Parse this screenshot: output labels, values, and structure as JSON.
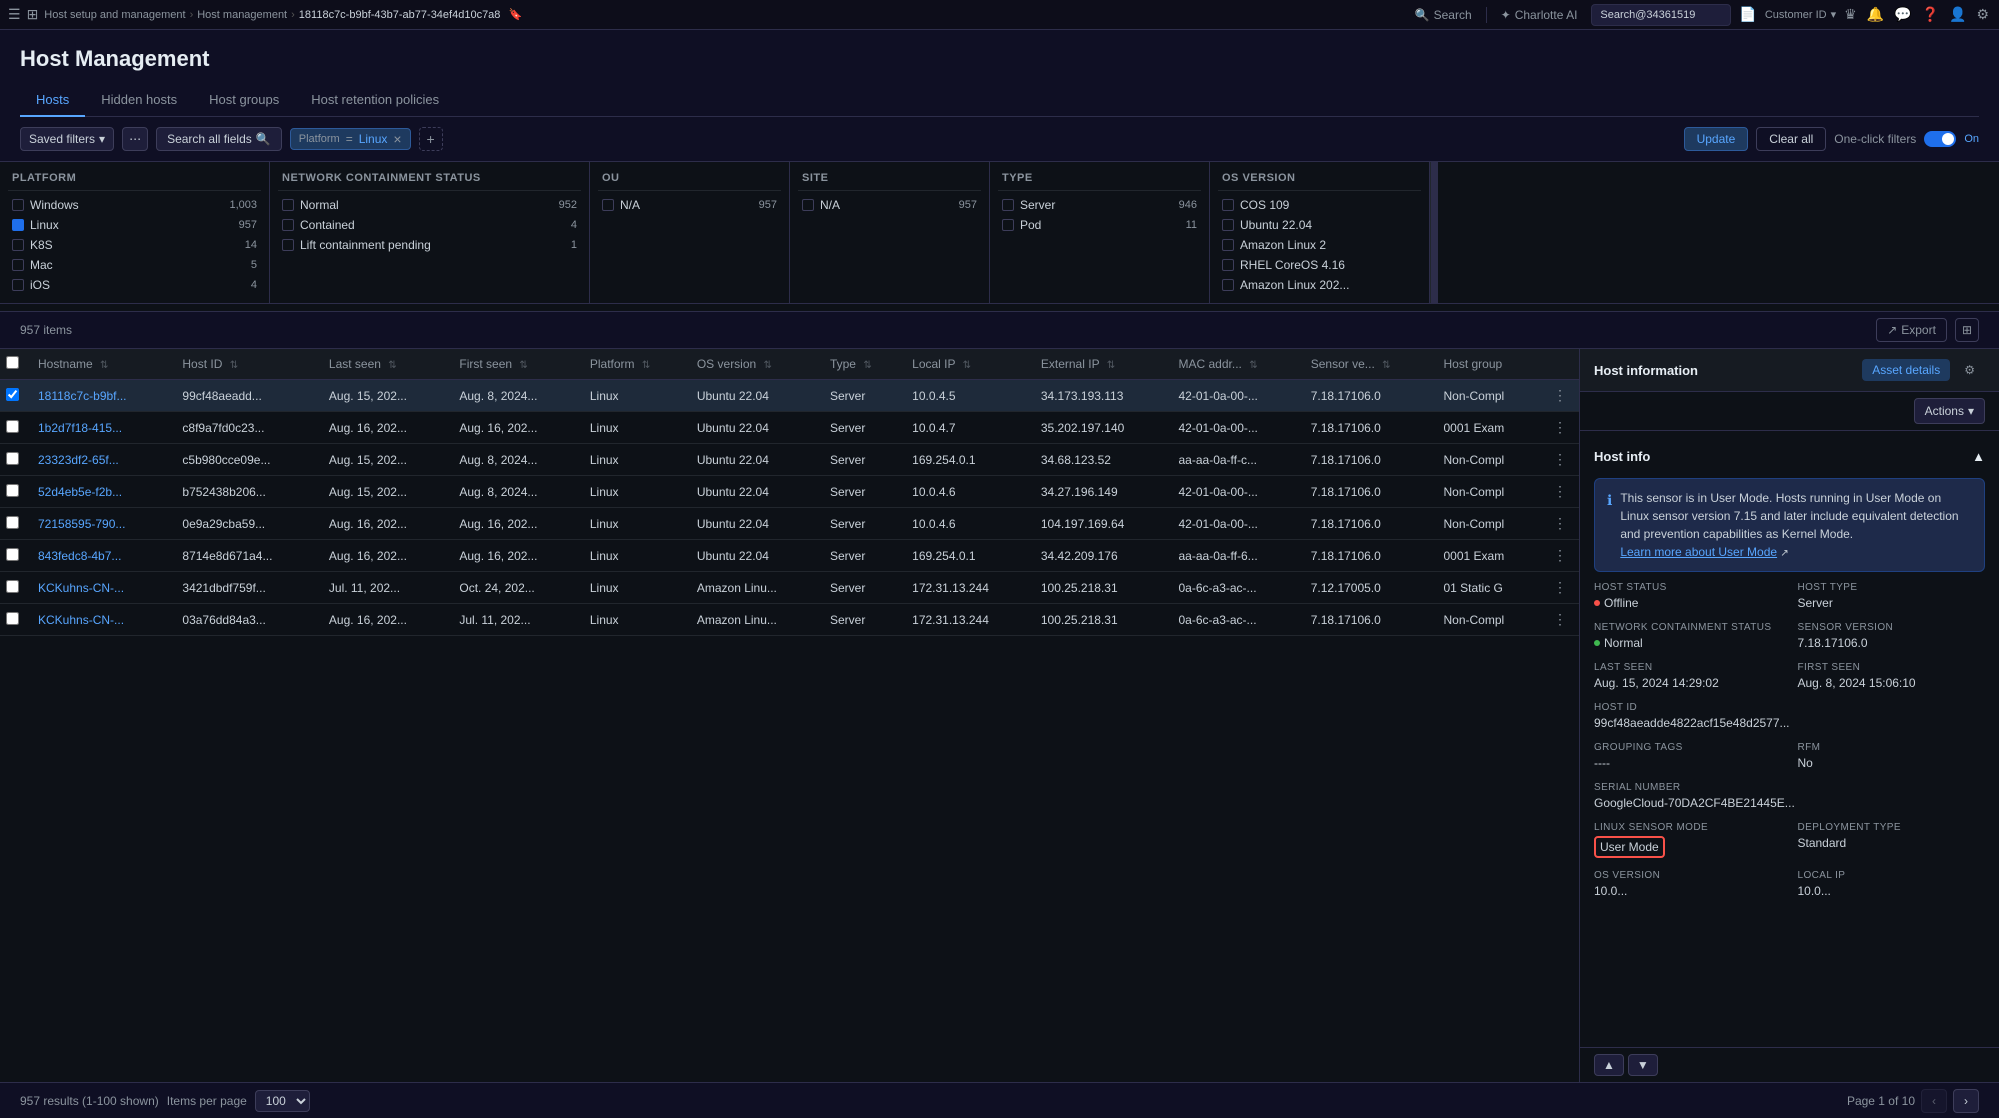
{
  "topbar": {
    "menu_icon": "≡",
    "grid_icon": "⊞",
    "breadcrumb": {
      "root": "Host setup and management",
      "parent": "Host management",
      "current": "18118c7c-b9bf-43b7-ab77-34ef4d10c7a8"
    },
    "bookmark_icon": "🔖",
    "search_label": "Search",
    "divider": "|",
    "charlotte_label": "Charlotte AI",
    "top_search_value": "Search@34361519",
    "customer_id_label": "Customer ID",
    "icons": [
      "📄",
      "🔔",
      "💬",
      "❓",
      "👤",
      "⚙️"
    ]
  },
  "page": {
    "title": "Host Management",
    "tabs": [
      {
        "id": "hosts",
        "label": "Hosts",
        "active": true
      },
      {
        "id": "hidden-hosts",
        "label": "Hidden hosts",
        "active": false
      },
      {
        "id": "host-groups",
        "label": "Host groups",
        "active": false
      },
      {
        "id": "host-retention",
        "label": "Host retention policies",
        "active": false
      }
    ]
  },
  "filter_bar": {
    "saved_filters_label": "Saved filters",
    "search_all_label": "Search all fields",
    "filter_chip_label": "Platform",
    "filter_chip_value": "Linux",
    "add_filter_icon": "+",
    "update_label": "Update",
    "clear_label": "Clear all",
    "one_click_label": "One-click filters",
    "toggle_on_label": "On"
  },
  "facets": {
    "platform": {
      "header": "Platform",
      "items": [
        {
          "label": "Windows",
          "count": "1,003",
          "checked": false
        },
        {
          "label": "Linux",
          "count": "957",
          "checked": true
        },
        {
          "label": "K8S",
          "count": "14",
          "checked": false
        },
        {
          "label": "Mac",
          "count": "5",
          "checked": false
        },
        {
          "label": "iOS",
          "count": "4",
          "checked": false
        }
      ]
    },
    "network_containment": {
      "header": "Network containment status",
      "items": [
        {
          "label": "Normal",
          "count": "952",
          "checked": false
        },
        {
          "label": "Contained",
          "count": "4",
          "checked": false
        },
        {
          "label": "Lift containment pending",
          "count": "1",
          "checked": false
        }
      ]
    },
    "ou": {
      "header": "OU",
      "items": [
        {
          "label": "N/A",
          "count": "957",
          "checked": false
        }
      ]
    },
    "site": {
      "header": "Site",
      "items": [
        {
          "label": "N/A",
          "count": "957",
          "checked": false
        }
      ]
    },
    "type": {
      "header": "Type",
      "items": [
        {
          "label": "Server",
          "count": "946",
          "checked": false
        },
        {
          "label": "Pod",
          "count": "11",
          "checked": false
        }
      ]
    },
    "os_version": {
      "header": "OS Version",
      "items": [
        {
          "label": "COS 109",
          "count": "",
          "checked": false
        },
        {
          "label": "Ubuntu 22.04",
          "count": "",
          "checked": false
        },
        {
          "label": "Amazon Linux 2",
          "count": "",
          "checked": false
        },
        {
          "label": "RHEL CoreOS 4.16",
          "count": "",
          "checked": false
        },
        {
          "label": "Amazon Linux 202...",
          "count": "",
          "checked": false
        }
      ]
    }
  },
  "results": {
    "count_label": "957 items",
    "export_label": "Export"
  },
  "table": {
    "columns": [
      "Hostname",
      "Host ID",
      "Last seen",
      "First seen",
      "Platform",
      "OS version",
      "Type",
      "Local IP",
      "External IP",
      "MAC addr...",
      "Sensor ve...",
      "Host group"
    ],
    "rows": [
      {
        "hostname": "18118c7c-b9bf...",
        "host_id": "99cf48aeadd...",
        "last_seen": "Aug. 15, 202...",
        "first_seen": "Aug. 8, 2024...",
        "platform": "Linux",
        "os_version": "Ubuntu 22.04",
        "type": "Server",
        "local_ip": "10.0.4.5",
        "external_ip": "34.173.193.113",
        "mac_addr": "42-01-0a-00-...",
        "sensor_ver": "7.18.17106.0",
        "host_group": "Non-Compl",
        "selected": true
      },
      {
        "hostname": "1b2d7f18-415...",
        "host_id": "c8f9a7fd0c23...",
        "last_seen": "Aug. 16, 202...",
        "first_seen": "Aug. 16, 202...",
        "platform": "Linux",
        "os_version": "Ubuntu 22.04",
        "type": "Server",
        "local_ip": "10.0.4.7",
        "external_ip": "35.202.197.140",
        "mac_addr": "42-01-0a-00-...",
        "sensor_ver": "7.18.17106.0",
        "host_group": "0001 Exam",
        "selected": false
      },
      {
        "hostname": "23323df2-65f...",
        "host_id": "c5b980cce09e...",
        "last_seen": "Aug. 15, 202...",
        "first_seen": "Aug. 8, 2024...",
        "platform": "Linux",
        "os_version": "Ubuntu 22.04",
        "type": "Server",
        "local_ip": "169.254.0.1",
        "external_ip": "34.68.123.52",
        "mac_addr": "aa-aa-0a-ff-c...",
        "sensor_ver": "7.18.17106.0",
        "host_group": "Non-Compl",
        "selected": false
      },
      {
        "hostname": "52d4eb5e-f2b...",
        "host_id": "b752438b206...",
        "last_seen": "Aug. 15, 202...",
        "first_seen": "Aug. 8, 2024...",
        "platform": "Linux",
        "os_version": "Ubuntu 22.04",
        "type": "Server",
        "local_ip": "10.0.4.6",
        "external_ip": "34.27.196.149",
        "mac_addr": "42-01-0a-00-...",
        "sensor_ver": "7.18.17106.0",
        "host_group": "Non-Compl",
        "selected": false
      },
      {
        "hostname": "72158595-790...",
        "host_id": "0e9a29cba59...",
        "last_seen": "Aug. 16, 202...",
        "first_seen": "Aug. 16, 202...",
        "platform": "Linux",
        "os_version": "Ubuntu 22.04",
        "type": "Server",
        "local_ip": "10.0.4.6",
        "external_ip": "104.197.169.64",
        "mac_addr": "42-01-0a-00-...",
        "sensor_ver": "7.18.17106.0",
        "host_group": "Non-Compl",
        "selected": false
      },
      {
        "hostname": "843fedc8-4b7...",
        "host_id": "8714e8d671a4...",
        "last_seen": "Aug. 16, 202...",
        "first_seen": "Aug. 16, 202...",
        "platform": "Linux",
        "os_version": "Ubuntu 22.04",
        "type": "Server",
        "local_ip": "169.254.0.1",
        "external_ip": "34.42.209.176",
        "mac_addr": "aa-aa-0a-ff-6...",
        "sensor_ver": "7.18.17106.0",
        "host_group": "0001 Exam",
        "selected": false
      },
      {
        "hostname": "KCKuhns-CN-...",
        "host_id": "3421dbdf759f...",
        "last_seen": "Jul. 11, 202...",
        "first_seen": "Oct. 24, 202...",
        "platform": "Linux",
        "os_version": "Amazon Linu...",
        "type": "Server",
        "local_ip": "172.31.13.244",
        "external_ip": "100.25.218.31",
        "mac_addr": "0a-6c-a3-ac-...",
        "sensor_ver": "7.12.17005.0",
        "host_group": "01 Static G",
        "selected": false
      },
      {
        "hostname": "KCKuhns-CN-...",
        "host_id": "03a76dd84a3...",
        "last_seen": "Aug. 16, 202...",
        "first_seen": "Jul. 11, 202...",
        "platform": "Linux",
        "os_version": "Amazon Linu...",
        "type": "Server",
        "local_ip": "172.31.13.244",
        "external_ip": "100.25.218.31",
        "mac_addr": "0a-6c-a3-ac-...",
        "sensor_ver": "7.18.17106.0",
        "host_group": "Non-Compl",
        "selected": false
      }
    ]
  },
  "detail_panel": {
    "title": "Host information",
    "tabs": [
      {
        "label": "Asset details",
        "active": true
      },
      {
        "label": "⚙",
        "active": false
      }
    ],
    "actions_label": "Actions",
    "host_info_section": "Host info",
    "info_banner": "This sensor is in User Mode. Hosts running in User Mode on Linux sensor version 7.15 and later include equivalent detection and prevention capabilities as Kernel Mode.",
    "learn_more_label": "Learn more about User Mode",
    "fields": {
      "host_status_label": "Host status",
      "host_status_value": "Offline",
      "host_type_label": "Host type",
      "host_type_value": "Server",
      "network_containment_label": "Network containment status",
      "network_containment_value": "Normal",
      "sensor_version_label": "Sensor version",
      "sensor_version_value": "7.18.17106.0",
      "last_seen_label": "Last seen",
      "last_seen_value": "Aug. 15, 2024 14:29:02",
      "first_seen_label": "First seen",
      "first_seen_value": "Aug. 8, 2024 15:06:10",
      "host_id_label": "Host ID",
      "host_id_value": "99cf48aeadde4822acf15e48d2577...",
      "grouping_tags_label": "Grouping tags",
      "grouping_tags_value": "----",
      "rfm_label": "RFM",
      "rfm_value": "No",
      "serial_number_label": "Serial number",
      "serial_number_value": "GoogleCloud-70DA2CF4BE21445E...",
      "linux_sensor_mode_label": "Linux sensor mode",
      "linux_sensor_mode_value": "User Mode",
      "deployment_type_label": "Deployment type",
      "deployment_type_value": "Standard",
      "os_version_label": "OS version",
      "os_version_value": "10.0...",
      "local_ip_label": "Local IP",
      "local_ip_value": "10.0..."
    },
    "nav": {
      "up_label": "▲",
      "down_label": "▼"
    }
  },
  "bottom_bar": {
    "results_label": "957 results (1-100 shown)",
    "items_per_page_label": "Items per page",
    "per_page_value": "100",
    "page_info": "Page 1 of 10",
    "prev_disabled": true,
    "next_disabled": false
  }
}
